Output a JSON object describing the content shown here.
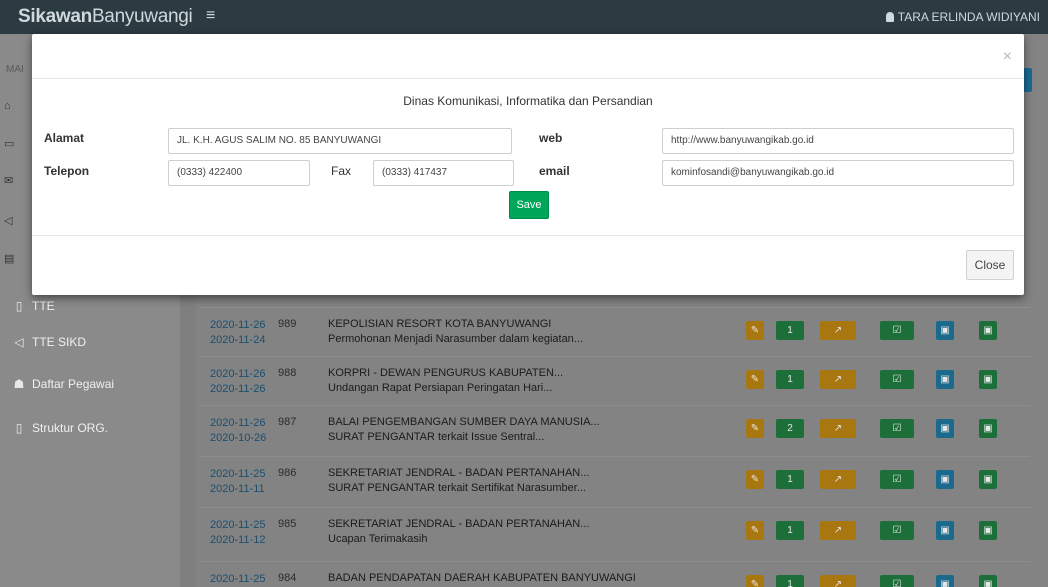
{
  "app": {
    "brand_bold": "Sikawan",
    "brand_rest": "Banyuwangi",
    "user_name": "TARA ERLINDA WIDIYANI"
  },
  "sidebar": {
    "header": "MAI",
    "items": [
      {
        "label": "TTE",
        "icon": "file-icon"
      },
      {
        "label": "TTE SIKD",
        "icon": "bullhorn-icon"
      },
      {
        "label": "Daftar Pegawai",
        "icon": "users-icon"
      },
      {
        "label": "Struktur ORG.",
        "icon": "file-icon"
      }
    ]
  },
  "table": {
    "rows": [
      {
        "date1": "2020-11-26",
        "date2": "2020-11-24",
        "num": "989",
        "line1": "KEPOLISIAN RESORT KOTA BANYUWANGI",
        "line2": "Permohonan Menjadi Narasumber dalam kegiatan...",
        "count": "1"
      },
      {
        "date1": "2020-11-26",
        "date2": "2020-11-26",
        "num": "988",
        "line1": "KORPRI - DEWAN PENGURUS KABUPATEN...",
        "line2": "Undangan Rapat Persiapan Peringatan Hari...",
        "count": "1"
      },
      {
        "date1": "2020-11-26",
        "date2": "2020-10-26",
        "num": "987",
        "line1": "BALAI PENGEMBANGAN SUMBER DAYA MANUSIA...",
        "line2": "SURAT PENGANTAR terkait Issue Sentral...",
        "count": "2"
      },
      {
        "date1": "2020-11-25",
        "date2": "2020-11-11",
        "num": "986",
        "line1": "SEKRETARIAT JENDRAL - BADAN PERTANAHAN...",
        "line2": "SURAT PENGANTAR terkait Sertifikat Narasumber...",
        "count": "1"
      },
      {
        "date1": "2020-11-25",
        "date2": "2020-11-12",
        "num": "985",
        "line1": "SEKRETARIAT JENDRAL - BADAN PERTANAHAN...",
        "line2": "Ucapan Terimakasih",
        "count": "1"
      },
      {
        "date1": "2020-11-25",
        "date2": "",
        "num": "984",
        "line1": "BADAN PENDAPATAN DAERAH KABUPATEN BANYUWANGI",
        "line2": "",
        "count": "1"
      }
    ]
  },
  "modal": {
    "close_x": "×",
    "title": "Dinas Komunikasi, Informatika dan Persandian",
    "labels": {
      "alamat": "Alamat",
      "telepon": "Telepon",
      "fax": "Fax",
      "web": "web",
      "email": "email"
    },
    "values": {
      "alamat": "JL. K.H. AGUS SALIM NO. 85 BANYUWANGI",
      "telepon": "(0333) 422400",
      "fax": "(0333) 417437",
      "web": "http://www.banyuwangikab.go.id",
      "email": "kominfosandi@banyuwangikab.go.id"
    },
    "save_label": "Save",
    "close_label": "Close"
  },
  "colors": {
    "save": "#00a65a",
    "edit": "#f39c12",
    "success": "#00a65a",
    "info": "#0073b7"
  }
}
